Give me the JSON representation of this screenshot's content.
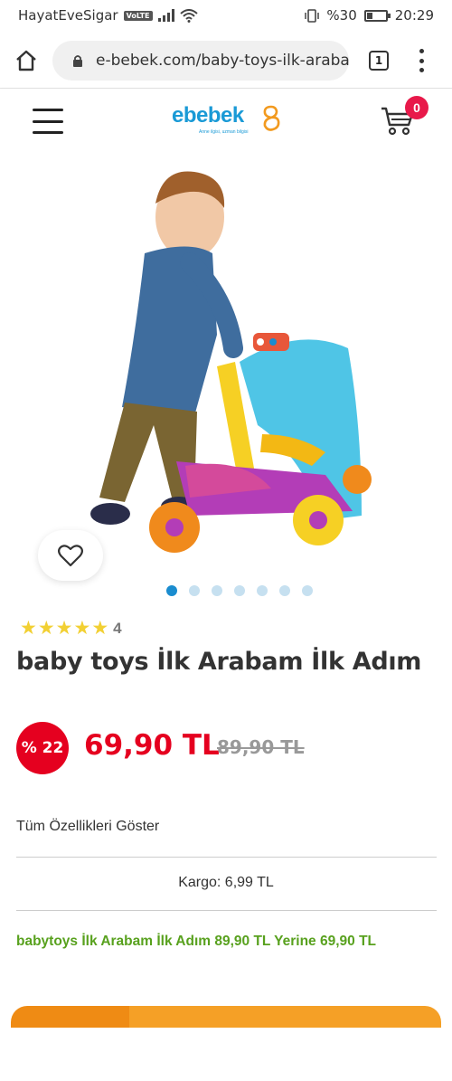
{
  "status_bar": {
    "carrier": "HayatEveSigar",
    "volte": "VoLTE",
    "battery_text": "%30",
    "battery_level": 0.3,
    "time": "20:29"
  },
  "browser": {
    "url": "e-bebek.com/baby-toys-ilk-araba",
    "tab_count": "1"
  },
  "header": {
    "logo_text": "ebebek",
    "logo_tagline": "Anne ilgisi, uzman bilgisi",
    "cart_count": "0"
  },
  "gallery": {
    "image_count": 7,
    "active_index": 0
  },
  "product": {
    "rating_stars": 5,
    "review_count": "4",
    "title": "baby toys İlk Arabam İlk Adım",
    "discount_badge": "% 22",
    "price": "69,90 TL",
    "old_price": "89,90 TL",
    "features_link": "Tüm Özellikleri Göster",
    "cargo": "Kargo: 6,99 TL",
    "promo": "babytoys İlk Arabam İlk Adım 89,90 TL Yerine 69,90 TL"
  },
  "colors": {
    "brand_blue": "#1a9ad6",
    "price_red": "#e5001f",
    "promo_green": "#58a11e",
    "cta_orange": "#f5a026"
  }
}
